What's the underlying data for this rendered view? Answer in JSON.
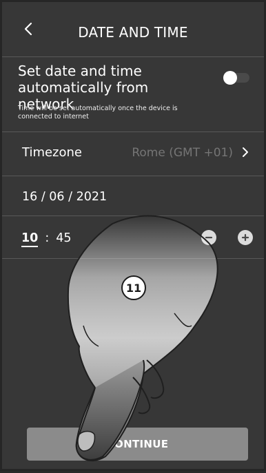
{
  "header": {
    "title": "DATE AND TIME",
    "back_icon": "chevron-left-icon"
  },
  "auto_network": {
    "title": "Set date and time automatically from network",
    "description": "Time will be set automatically once the device is connected to internet",
    "toggle_state": "off"
  },
  "timezone": {
    "label": "Timezone",
    "value": "Rome (GMT +01)",
    "chevron_icon": "chevron-right-icon"
  },
  "date": {
    "value": "16 / 06 / 2021"
  },
  "time": {
    "hour": "10",
    "separator": ":",
    "minute": "45",
    "minus_icon": "minus-circle-icon",
    "plus_icon": "plus-circle-icon"
  },
  "step_badge": "11",
  "footer": {
    "continue_label": "CONTINUE"
  },
  "colors": {
    "background": "#373737",
    "divider": "#595959",
    "muted_text": "#757575",
    "button": "#8b8b8b"
  }
}
